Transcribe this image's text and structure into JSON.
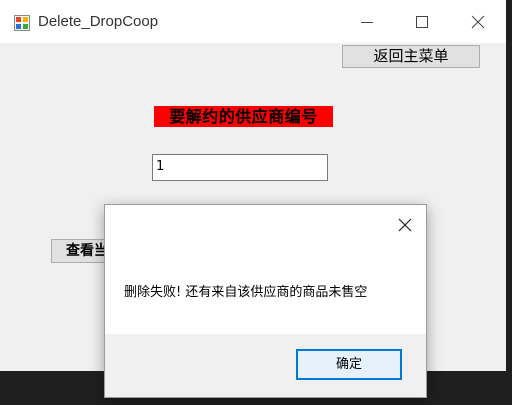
{
  "window": {
    "title": "Delete_DropCoop",
    "buttons": {
      "minimize": "minimize",
      "maximize": "maximize",
      "close": "close"
    }
  },
  "main": {
    "back_button": "返回主菜单",
    "supplier_label": "要解约的供应商编号",
    "supplier_id_value": "1",
    "view_button": "查看当"
  },
  "dialog": {
    "message": "删除失败! 还有来自该供应商的商品未售空",
    "ok_button": "确定"
  },
  "colors": {
    "label_background": "#ff0000",
    "ok_border": "#0078d7"
  }
}
